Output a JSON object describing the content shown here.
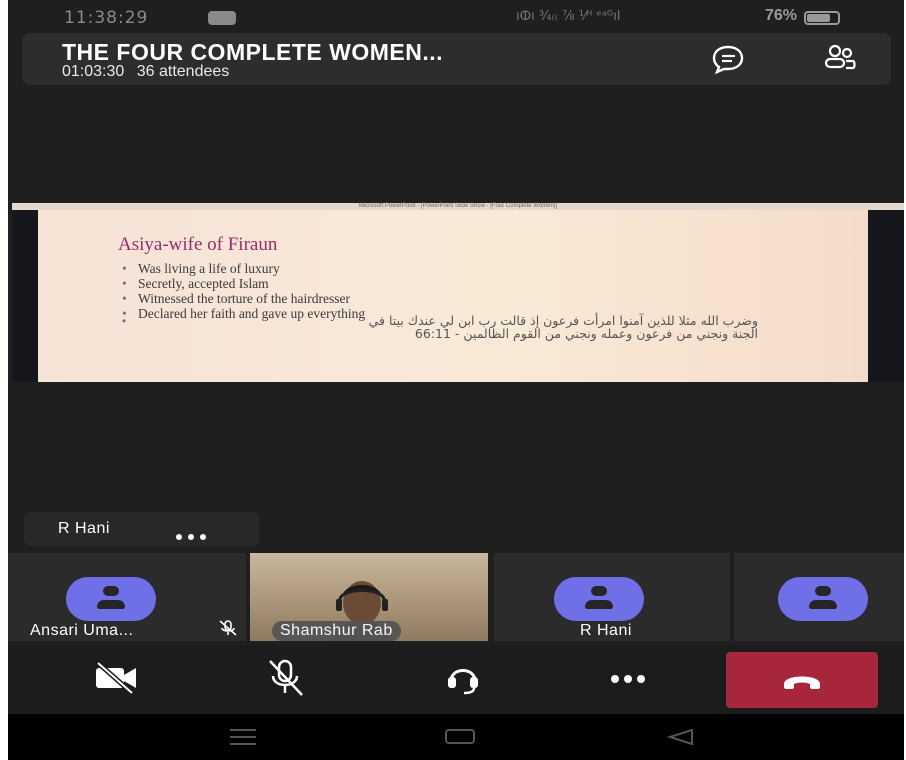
{
  "status_bar": {
    "time": "11:38:29",
    "network_info": "ıⵀı ¾₍₍ ⅞ ⅟ᴴ ᵉᵃᴳıl",
    "signal": "..ıl",
    "battery_percent": "76%",
    "battery_level": 0.76
  },
  "meeting": {
    "title": "THE FOUR COMPLETE WOMEN...",
    "duration": "01:03:30",
    "attendees": "36 attendees",
    "chat_icon": "chat-icon",
    "participants_icon": "people-icon"
  },
  "shared_screen": {
    "window_title": "Microsoft PowerPoint - [PowerPoint Slide Show - [Four Complete Women]]",
    "slide_title": "Asiya-wife of Firaun",
    "bullets": [
      "Was living a life of luxury",
      "Secretly, accepted Islam",
      "Witnessed the torture of the hairdresser",
      "Declared her faith and gave up everything"
    ],
    "arabic_line1": "وضرب الله مثلا للذين آمنوا امرأت فرعون إذ قالت رب ابن لي عندك بيتا في",
    "arabic_line2": "الجنة ونجني من فرعون وعمله ونجني من القوم الظالمين - 66:11"
  },
  "active_speaker": {
    "name": "R Hani",
    "more_icon": "more-icon"
  },
  "participants": [
    {
      "name": "Ansari Uma...",
      "muted": true
    },
    {
      "name": "Shamshur Rab",
      "video": true
    },
    {
      "name": "R Hani"
    },
    {
      "name": ""
    }
  ],
  "controls": {
    "camera": "camera-off-icon",
    "mic": "mic-off-icon",
    "audio": "headset-icon",
    "more": "more-icon",
    "hangup": "hang-up-icon",
    "hangup_color": "#a8263b"
  },
  "colors": {
    "background": "#1f1f1f",
    "avatar": "#6f6fe8",
    "slide_title": "#9b2c6a"
  }
}
